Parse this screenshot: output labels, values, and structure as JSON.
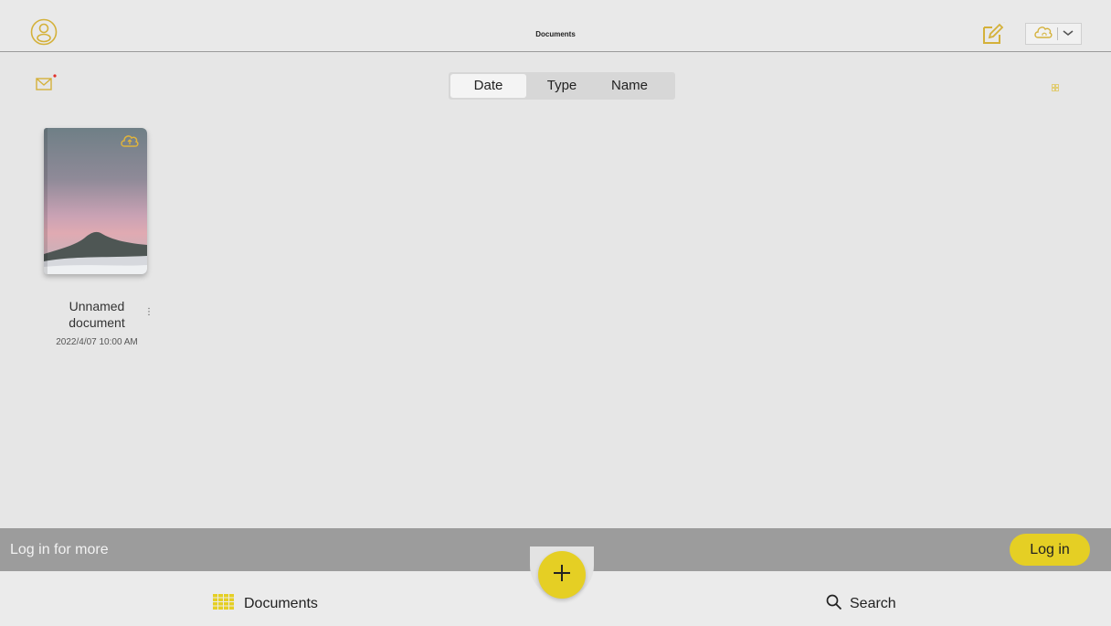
{
  "header": {
    "title": "Documents",
    "avatar_icon": "user-avatar-icon",
    "edit_icon": "edit-note-icon",
    "cloud_icon": "cloud-home-icon",
    "dropdown_icon": "chevron-down-icon"
  },
  "toolbar": {
    "mail_icon": "mail-icon",
    "sort_options": [
      "Date",
      "Type",
      "Name"
    ],
    "selected_sort": "Date",
    "view_icon": "grid-view-icon"
  },
  "documents": [
    {
      "name": "Unnamed document",
      "date": "2022/4/07 10:00 AM",
      "status_icon": "cloud-upload-icon",
      "menu_icon": "more-vertical-icon"
    }
  ],
  "banner": {
    "message": "Log in for more",
    "login_label": "Log in"
  },
  "bottom_nav": {
    "documents_label": "Documents",
    "search_label": "Search",
    "add_icon": "plus-icon"
  },
  "colors": {
    "accent": "#e5cf24",
    "icon_gold": "#d4b13a",
    "background": "#e6e6e6",
    "banner": "#9c9c9c"
  }
}
